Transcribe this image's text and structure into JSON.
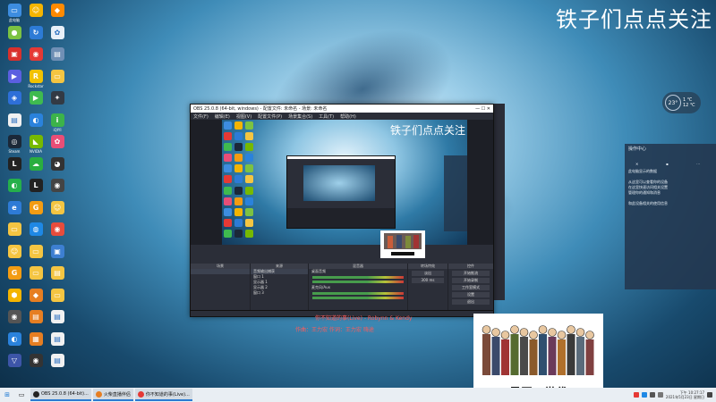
{
  "overlay_title": "铁子们点点关注",
  "desktop_icons": [
    {
      "label": "此电脑",
      "color": "#3d8de0",
      "glyph": "▭"
    },
    {
      "label": "",
      "color": "#f4b400",
      "glyph": "☺"
    },
    {
      "label": "",
      "color": "#ff8a00",
      "glyph": "◆"
    },
    {
      "label": "",
      "color": "#7cc242",
      "glyph": "●"
    },
    {
      "label": "",
      "color": "#2d7bd6",
      "glyph": "↻"
    },
    {
      "label": "",
      "color": "#e8f0f8",
      "glyph": "✿"
    },
    {
      "label": "",
      "color": "#d9302c",
      "glyph": "▣"
    },
    {
      "label": "",
      "color": "#e53935",
      "glyph": "◉"
    },
    {
      "label": "",
      "color": "#6f8fb5",
      "glyph": "▤"
    },
    {
      "label": "",
      "color": "#5b5fe0",
      "glyph": "▶"
    },
    {
      "label": "Rockstar",
      "color": "#f2c200",
      "glyph": "R"
    },
    {
      "label": "",
      "color": "#f4c542",
      "glyph": "▭"
    },
    {
      "label": "",
      "color": "#2e6fd8",
      "glyph": "◈"
    },
    {
      "label": "",
      "color": "#3fba4f",
      "glyph": "▶"
    },
    {
      "label": "",
      "color": "#333a44",
      "glyph": "✦"
    },
    {
      "label": "",
      "color": "#f1f1f1",
      "glyph": "▤"
    },
    {
      "label": "",
      "color": "#2a82dc",
      "glyph": "◐"
    },
    {
      "label": "iQIYI",
      "color": "#3cb34a",
      "glyph": "i"
    },
    {
      "label": "Steam",
      "color": "#1b2838",
      "glyph": "◎"
    },
    {
      "label": "NVIDIA",
      "color": "#76b900",
      "glyph": "◣"
    },
    {
      "label": "",
      "color": "#e94e77",
      "glyph": "✿"
    },
    {
      "label": "",
      "color": "#222",
      "glyph": "L"
    },
    {
      "label": "",
      "color": "#2aae3f",
      "glyph": "☁"
    },
    {
      "label": "",
      "color": "#333",
      "glyph": "◕"
    },
    {
      "label": "",
      "color": "#25b04b",
      "glyph": "◐"
    },
    {
      "label": "",
      "color": "#222",
      "glyph": "L"
    },
    {
      "label": "",
      "color": "#444",
      "glyph": "◉"
    },
    {
      "label": "",
      "color": "#2e7bd6",
      "glyph": "e"
    },
    {
      "label": "",
      "color": "#f39c12",
      "glyph": "G"
    },
    {
      "label": "",
      "color": "#f4c542",
      "glyph": "☺"
    },
    {
      "label": "",
      "color": "#f4c542",
      "glyph": "▭"
    },
    {
      "label": "",
      "color": "#1e88e5",
      "glyph": "◍"
    },
    {
      "label": "",
      "color": "#e74c3c",
      "glyph": "◉"
    },
    {
      "label": "",
      "color": "#f4c542",
      "glyph": "☺"
    },
    {
      "label": "",
      "color": "#f4c542",
      "glyph": "▭"
    },
    {
      "label": "",
      "color": "#3d7fd1",
      "glyph": "▣"
    },
    {
      "label": "",
      "color": "#f39c12",
      "glyph": "G"
    },
    {
      "label": "",
      "color": "#f4c542",
      "glyph": "▭"
    },
    {
      "label": "",
      "color": "#f4c542",
      "glyph": "▤"
    },
    {
      "label": "",
      "color": "#f4b400",
      "glyph": "⬢"
    },
    {
      "label": "",
      "color": "#e67e22",
      "glyph": "◆"
    },
    {
      "label": "",
      "color": "#f4c542",
      "glyph": "▭"
    },
    {
      "label": "",
      "color": "#555",
      "glyph": "◉"
    },
    {
      "label": "",
      "color": "#e67e22",
      "glyph": "▤"
    },
    {
      "label": "",
      "color": "#f1f1f1",
      "glyph": "▤"
    },
    {
      "label": "",
      "color": "#2a82dc",
      "glyph": "◐"
    },
    {
      "label": "",
      "color": "#e67e22",
      "glyph": "▦"
    },
    {
      "label": "",
      "color": "#f1f1f1",
      "glyph": "▤"
    },
    {
      "label": "",
      "color": "#3d55a8",
      "glyph": "▽"
    },
    {
      "label": "",
      "color": "#333",
      "glyph": "◉"
    },
    {
      "label": "",
      "color": "#f1f1f1",
      "glyph": "▤"
    }
  ],
  "obs": {
    "title": "OBS 25.0.8 (64-bit, windows) - 配置文件: 未命名 - 场景: 未命名",
    "menu": [
      "文件(F)",
      "编辑(E)",
      "视图(V)",
      "配置文件(P)",
      "场景集合(S)",
      "工具(T)",
      "帮助(H)"
    ],
    "inner_title": "铁子们点点关注",
    "docks": {
      "scenes_header": "场景",
      "sources_header": "来源",
      "sources": [
        "音频输出捕获",
        "窗口 1",
        "显示器 1",
        "显示器 2",
        "窗口 3"
      ],
      "mixer_header": "混音器",
      "mixer_tracks": [
        "桌面音频",
        "麦克风/Aux"
      ],
      "transitions_header": "转场特效",
      "transition_value": "淡出",
      "transition_duration": "300 ms",
      "controls_header": "控件",
      "controls": [
        "开始推流",
        "开始录制",
        "工作室模式",
        "设置",
        "退出"
      ]
    }
  },
  "right_panel": {
    "header": "操作中心",
    "lines": [
      "此电脑显示的数据",
      "",
      "从这里可以查看你的设备",
      "在这里快速访问相关设置",
      "管理你的通知和消息",
      "",
      "和此设备相关的使用信息"
    ]
  },
  "weather": {
    "temp": "23°",
    "line1": "1 ℃",
    "line2": "12 ℃"
  },
  "lyrics": {
    "song": "你不知道的事(Live) - Robynn & Kendy",
    "credits": "作曲：王力宏 作词：王力宏 嗨途"
  },
  "poster": {
    "title": "最恶の世代"
  },
  "taskbar": {
    "items": [
      {
        "label": "OBS 25.0.8 (64-bit)...",
        "color": "#222"
      },
      {
        "label": "火柴直播伴侣",
        "color": "#e67e22"
      },
      {
        "label": "你不知道的事(Live)...",
        "color": "#e53935"
      }
    ],
    "clock_time": "下午 10:27:17",
    "clock_date": "2021年5月23日 星期日"
  }
}
